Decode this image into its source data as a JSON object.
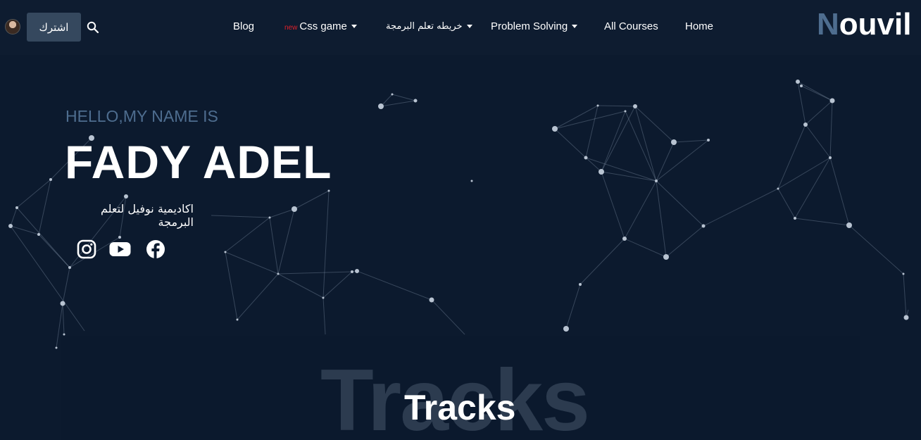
{
  "nav": {
    "subscribe_label": "اشترك",
    "search_icon": "search-icon",
    "items": [
      {
        "label": "Blog"
      },
      {
        "badge": "new",
        "label": "Css game"
      },
      {
        "label": "خريطه تعلم البرمجة"
      },
      {
        "label": "Problem Solving"
      },
      {
        "label": "All Courses"
      },
      {
        "label": "Home"
      }
    ],
    "logo_first": "N",
    "logo_rest": "ouvil"
  },
  "hero": {
    "hello": "HELLO,MY NAME IS",
    "name": "FADY ADEL",
    "tagline": "اكاديمية نوفيل لتعلم البرمجة",
    "social": [
      "instagram-icon",
      "youtube-icon",
      "facebook-icon"
    ]
  },
  "tracks": {
    "background_text": "Tracks",
    "title": "Tracks"
  },
  "colors": {
    "background": "#0c1a2e",
    "navbar": "#0e1c30",
    "accent": "#4e6d8f",
    "button": "#35485e",
    "badge": "#e0202a"
  }
}
